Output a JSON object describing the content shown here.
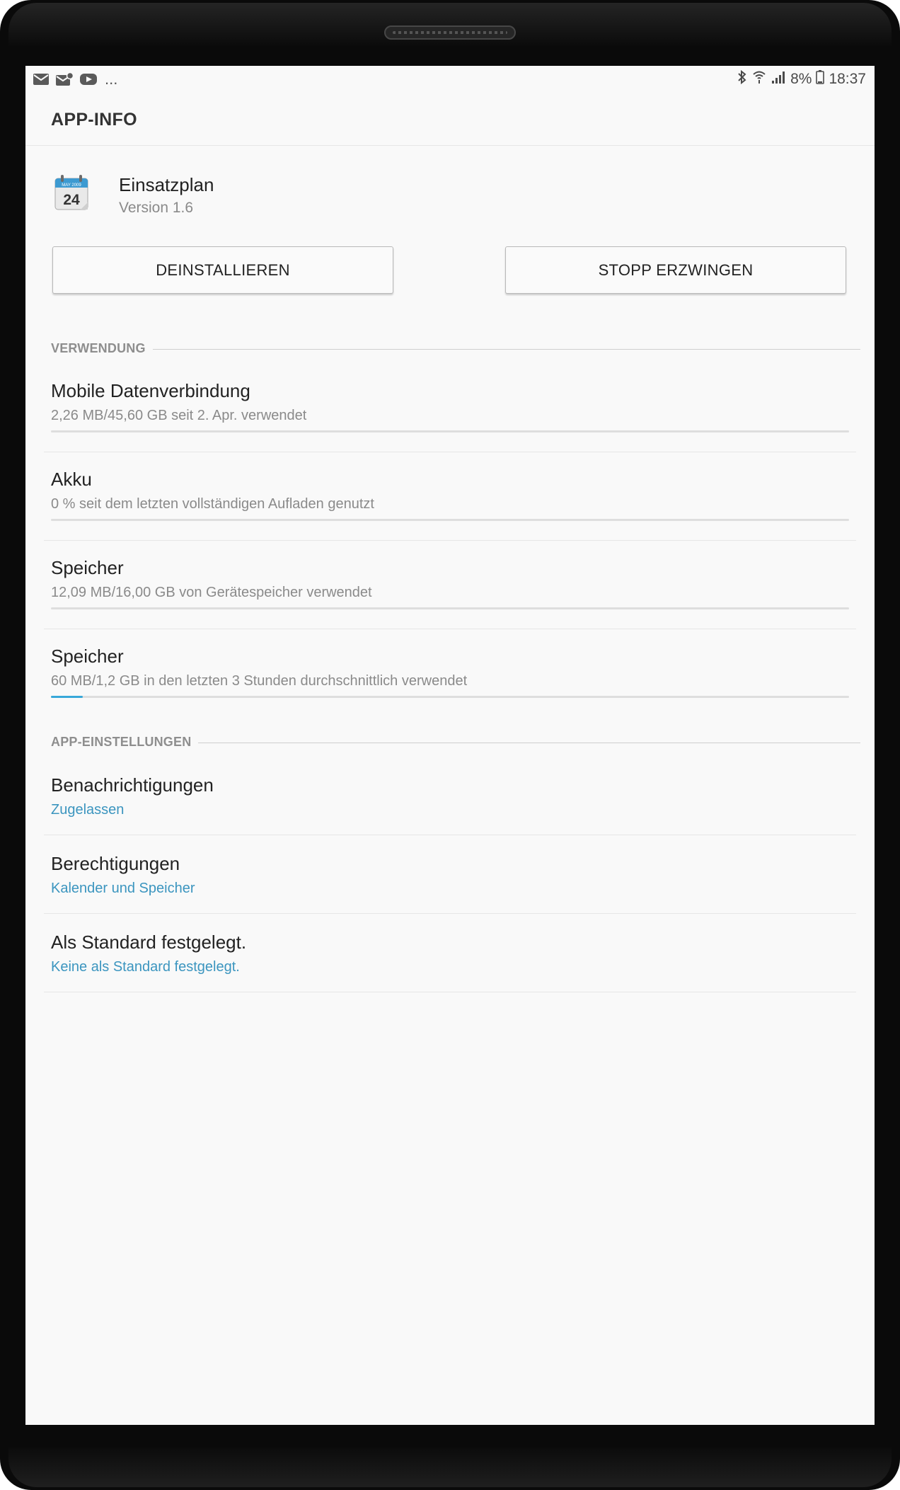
{
  "status_bar": {
    "icons_left": [
      "mail-icon",
      "mail-sync-icon",
      "youtube-icon"
    ],
    "more": "...",
    "icons_right": [
      "bluetooth-icon",
      "wifi-icon",
      "signal-icon",
      "battery-icon"
    ],
    "battery": "8%",
    "time": "18:37"
  },
  "header": {
    "title": "APP-INFO"
  },
  "app": {
    "icon": "calendar-icon",
    "icon_month": "MAY 2009",
    "icon_day": "24",
    "name": "Einsatzplan",
    "version": "Version 1.6"
  },
  "buttons": {
    "uninstall": "DEINSTALLIEREN",
    "force_stop": "STOPP ERZWINGEN"
  },
  "usage": {
    "header": "VERWENDUNG",
    "items": [
      {
        "title": "Mobile Datenverbindung",
        "subtitle": "2,26 MB/45,60 GB seit 2. Apr. verwendet",
        "progress": 0.0
      },
      {
        "title": "Akku",
        "subtitle": "0 % seit dem letzten vollständigen Aufladen genutzt",
        "progress": 0.0
      },
      {
        "title": "Speicher",
        "subtitle": "12,09 MB/16,00 GB von Gerätespeicher verwendet",
        "progress": 0.0
      },
      {
        "title": "Speicher",
        "subtitle": "60 MB/1,2 GB in den letzten 3 Stunden durchschnittlich verwendet",
        "progress": 0.04
      }
    ]
  },
  "settings": {
    "header": "APP-EINSTELLUNGEN",
    "items": [
      {
        "title": "Benachrichtigungen",
        "subtitle": "Zugelassen"
      },
      {
        "title": "Berechtigungen",
        "subtitle": "Kalender und Speicher"
      },
      {
        "title": "Als Standard festgelegt.",
        "subtitle": "Keine als Standard festgelegt."
      }
    ]
  },
  "colors": {
    "accent": "#3b95bf",
    "progress": "#38a8d9",
    "background": "#f9f9f9"
  }
}
